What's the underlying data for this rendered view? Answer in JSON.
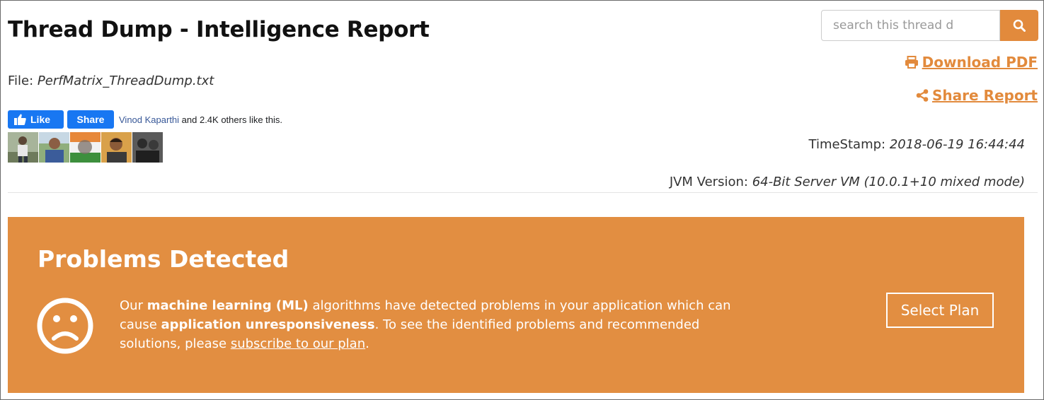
{
  "header": {
    "title": "Thread Dump - Intelligence Report",
    "file_label": "File:",
    "file_name": "PerfMatrix_ThreadDump.txt"
  },
  "facebook": {
    "like_label": "Like",
    "share_label": "Share",
    "friend_name": "Vinod Kaparthi",
    "like_suffix": " and 2.4K others like this."
  },
  "search": {
    "placeholder": "search this thread d",
    "value": ""
  },
  "actions": {
    "download_label": "Download PDF",
    "share_label": "Share Report"
  },
  "meta": {
    "timestamp_label": "TimeStamp:",
    "timestamp_value": "2018-06-19 16:44:44",
    "jvm_label": "JVM Version:",
    "jvm_value": "64-Bit Server VM (10.0.1+10 mixed mode)"
  },
  "banner": {
    "title": "Problems Detected",
    "msg_part1": "Our ",
    "msg_bold1": "machine learning (ML)",
    "msg_part2": " algorithms have detected problems in your application which can cause ",
    "msg_bold2": "application unresponsiveness",
    "msg_part3": ". To see the identified problems and recommended solutions, please ",
    "msg_link": "subscribe to our plan",
    "msg_end": ".",
    "button_label": "Select Plan"
  },
  "colors": {
    "accent": "#e28a3c",
    "banner": "#e28e41",
    "facebook": "#1877f2"
  }
}
